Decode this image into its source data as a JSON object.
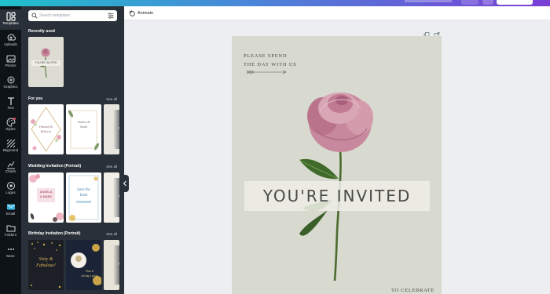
{
  "sidebar": {
    "items": [
      {
        "label": "Templates",
        "icon": "templates-icon"
      },
      {
        "label": "Uploads",
        "icon": "upload-icon"
      },
      {
        "label": "Photos",
        "icon": "photo-icon"
      },
      {
        "label": "Graphics",
        "icon": "shapes-icon"
      },
      {
        "label": "Text",
        "icon": "text-icon"
      },
      {
        "label": "Styles",
        "icon": "palette-icon"
      },
      {
        "label": "Bkground",
        "icon": "background-icon"
      },
      {
        "label": "Charts",
        "icon": "chart-icon"
      },
      {
        "label": "Logos",
        "icon": "logo-icon"
      },
      {
        "label": "Email",
        "icon": "email-icon"
      },
      {
        "label": "Folders",
        "icon": "folder-icon"
      },
      {
        "label": "More",
        "icon": "more-icon"
      }
    ]
  },
  "panel": {
    "search_placeholder": "Search templates",
    "sections": [
      {
        "title": "Recently used",
        "see_all": ""
      },
      {
        "title": "For you",
        "see_all": "See all"
      },
      {
        "title": "Wedding Invitation (Portrait)",
        "see_all": "See all"
      },
      {
        "title": "Birthday Invitation (Portrait)",
        "see_all": "See all"
      }
    ],
    "recent_thumb_text": "YOU'RE INVITED",
    "for_you_thumbs": [
      {
        "line1": "Hannah &",
        "line2": "Rebecca"
      },
      {
        "line1": "Andrea &",
        "line2": "Sarah"
      }
    ],
    "wedding_thumbs": [
      {
        "line1": "ANGELA",
        "line2": "& MARK"
      },
      {
        "line1": "Save the",
        "line2": "Date"
      }
    ],
    "birthday_thumbs": [
      {
        "line1": "Sixty &",
        "line2": "Fabulous!"
      },
      {
        "line1": "Tina is",
        "line2": "having a party"
      }
    ]
  },
  "toolbar": {
    "animate_label": "Animate"
  },
  "design": {
    "heading_line1": "PLEASE SPEND",
    "heading_line2": "THE DAY WITH US",
    "banner": "YOU'RE INVITED",
    "footer": "TO CELEBRATE"
  },
  "colors": {
    "rail": "#0e1318",
    "panel": "#293039",
    "page": "#d8d9cf",
    "rose": "#c7879c",
    "stem": "#4b6b2f"
  }
}
